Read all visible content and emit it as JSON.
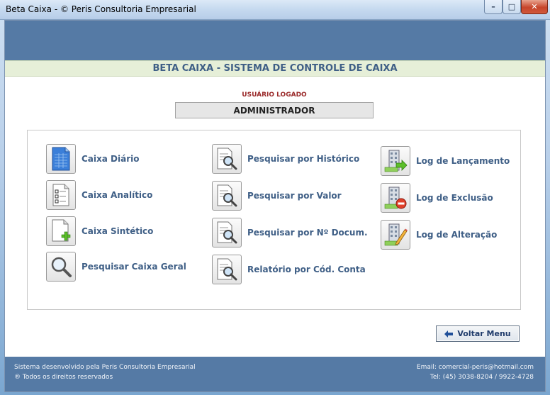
{
  "window": {
    "title": "Beta Caixa - © Peris Consultoria Empresarial",
    "minimize_icon": "minimize-icon",
    "maximize_icon": "maximize-icon",
    "close_icon": "close-icon"
  },
  "header": {
    "system_title": "BETA CAIXA - SISTEMA DE CONTROLE DE CAIXA"
  },
  "user": {
    "label": "USUÁRIO LOGADO",
    "value": "ADMINISTRADOR"
  },
  "menu": {
    "col1": [
      {
        "label": "Caixa Diário",
        "icon": "document-grid-icon"
      },
      {
        "label": "Caixa Analítico",
        "icon": "checklist-icon"
      },
      {
        "label": "Caixa Sintético",
        "icon": "document-add-icon"
      },
      {
        "label": "Pesquisar Caixa Geral",
        "icon": "magnifier-icon"
      }
    ],
    "col2": [
      {
        "label": "Pesquisar por Histórico",
        "icon": "search-report-icon"
      },
      {
        "label": "Pesquisar por Valor",
        "icon": "search-report-icon"
      },
      {
        "label": "Pesquisar por Nº Docum.",
        "icon": "search-report-icon"
      },
      {
        "label": "Relatório por Cód. Conta",
        "icon": "search-report-icon"
      }
    ],
    "col3": [
      {
        "label": "Log de Lançamento",
        "icon": "building-arrow-icon"
      },
      {
        "label": "Log de Exclusão",
        "icon": "building-delete-icon"
      },
      {
        "label": "Log de Alteração",
        "icon": "building-edit-icon"
      }
    ]
  },
  "buttons": {
    "back_label": "Voltar Menu",
    "back_icon": "arrow-left-icon"
  },
  "footer": {
    "left_line1": "Sistema desenvolvido pela Peris Consultoria Empresarial",
    "left_line2": "® Todos os direitos reservados",
    "right_line1": "Email: comercial-peris@hotmail.com",
    "right_line2": "Tel: (45) 3038-8204 / 9922-4728"
  },
  "colors": {
    "header_blue": "#557aa5",
    "label_blue": "#3f5f86",
    "system_bar": "#e6efd8"
  }
}
